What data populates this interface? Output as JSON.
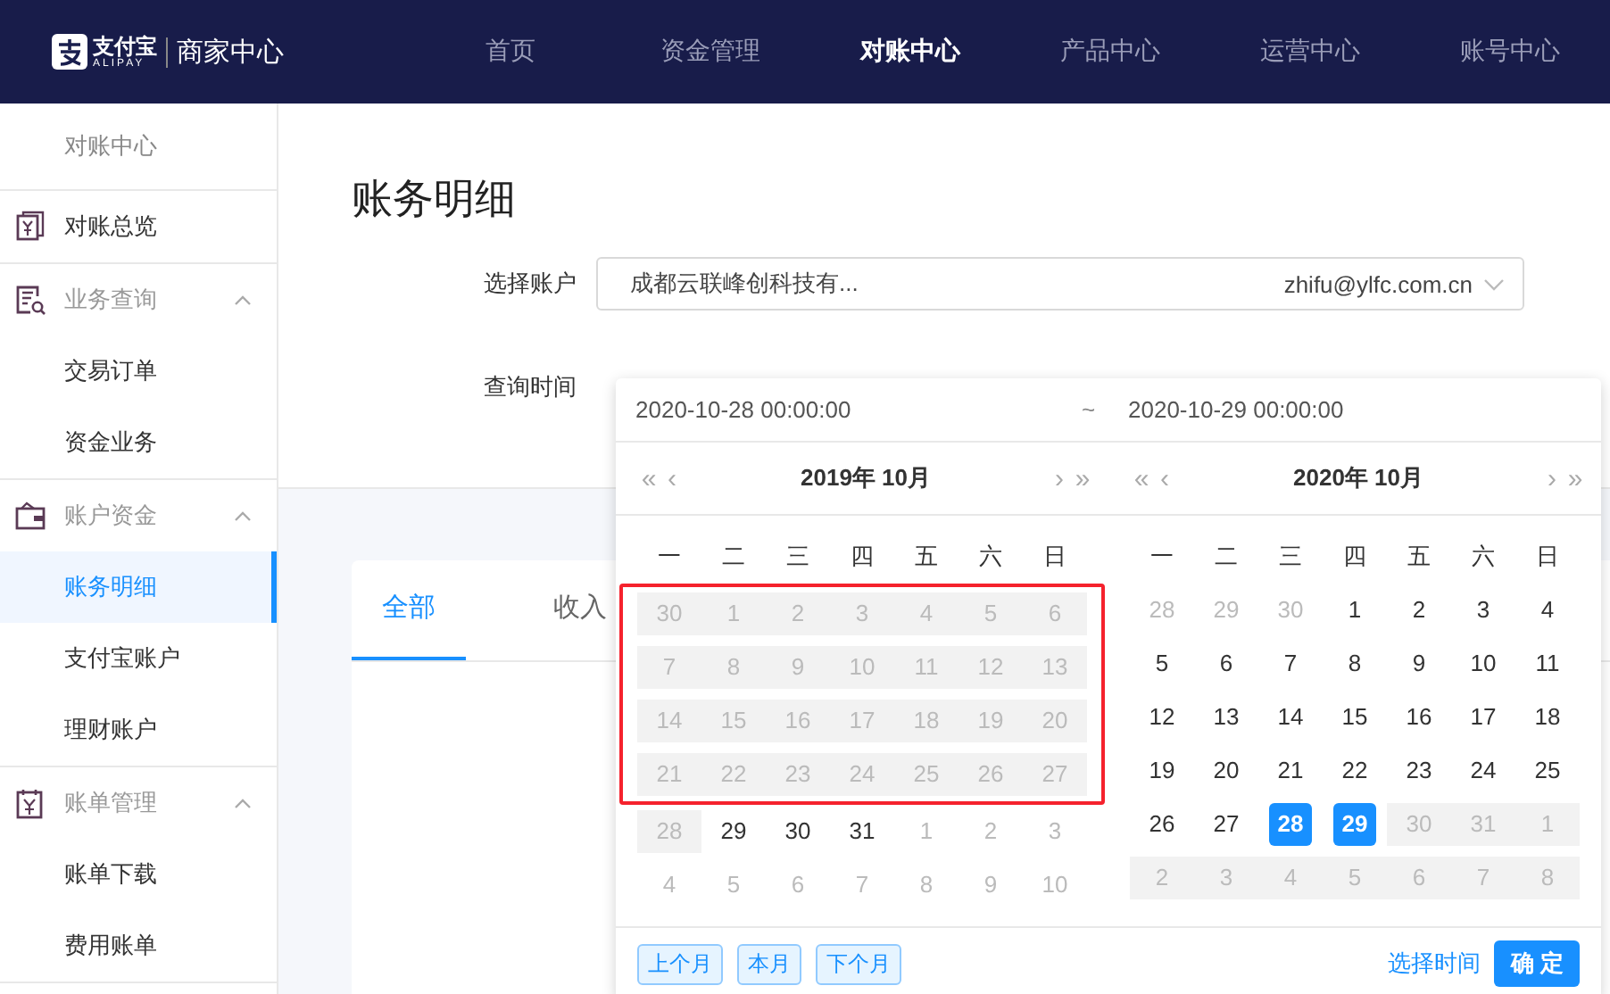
{
  "header": {
    "logo_mark": "支付宝",
    "logo_sub": "ALIPAY",
    "product": "商家中心",
    "nav": [
      {
        "label": "首页",
        "selected": false
      },
      {
        "label": "资金管理",
        "selected": false
      },
      {
        "label": "对账中心",
        "selected": true
      },
      {
        "label": "产品中心",
        "selected": false
      },
      {
        "label": "运营中心",
        "selected": false
      },
      {
        "label": "账号中心",
        "selected": false
      }
    ]
  },
  "sidebar": {
    "title": "对账中心",
    "items": [
      {
        "label": "对账总览",
        "selected": false
      },
      {
        "label": "业务查询",
        "expanded": true,
        "selected": false,
        "children": [
          {
            "label": "交易订单",
            "selected": false
          },
          {
            "label": "资金业务",
            "selected": false
          }
        ]
      },
      {
        "label": "账户资金",
        "expanded": true,
        "selected": false,
        "children": [
          {
            "label": "账务明细",
            "selected": true
          },
          {
            "label": "支付宝账户",
            "selected": false
          },
          {
            "label": "理财账户",
            "selected": false
          }
        ]
      },
      {
        "label": "账单管理",
        "expanded": true,
        "selected": false,
        "children": [
          {
            "label": "账单下载",
            "selected": false
          },
          {
            "label": "费用账单",
            "selected": false
          }
        ]
      }
    ]
  },
  "page": {
    "title": "账务明细",
    "account": {
      "label": "选择账户",
      "name": "成都云联峰创科技有...",
      "email": "zhifu@ylfc.com.cn"
    },
    "time_label": "查询时间",
    "tabs": [
      {
        "label": "全部",
        "selected": true
      },
      {
        "label": "收入",
        "selected": false
      }
    ]
  },
  "date_picker": {
    "start": "2020-10-28 00:00:00",
    "separator": "~",
    "end": "2020-10-29 00:00:00",
    "calendars": [
      {
        "title": "2019年 10月",
        "nav": {
          "prev_year": "«",
          "prev_month": "‹",
          "next_month": "›",
          "next_year": "»"
        },
        "weekdays": [
          "一",
          "二",
          "三",
          "四",
          "五",
          "六",
          "日"
        ],
        "groups": [
          {
            "highlighted": true,
            "weeks": [
              [
                {
                  "day": "30",
                  "kind": "disabled",
                  "selected": false
                },
                {
                  "day": "1",
                  "kind": "disabled",
                  "selected": false
                },
                {
                  "day": "2",
                  "kind": "disabled",
                  "selected": false
                },
                {
                  "day": "3",
                  "kind": "disabled",
                  "selected": false
                },
                {
                  "day": "4",
                  "kind": "disabled",
                  "selected": false
                },
                {
                  "day": "5",
                  "kind": "disabled",
                  "selected": false
                },
                {
                  "day": "6",
                  "kind": "disabled",
                  "selected": false
                }
              ],
              [
                {
                  "day": "7",
                  "kind": "disabled",
                  "selected": false
                },
                {
                  "day": "8",
                  "kind": "disabled",
                  "selected": false
                },
                {
                  "day": "9",
                  "kind": "disabled",
                  "selected": false
                },
                {
                  "day": "10",
                  "kind": "disabled",
                  "selected": false
                },
                {
                  "day": "11",
                  "kind": "disabled",
                  "selected": false
                },
                {
                  "day": "12",
                  "kind": "disabled",
                  "selected": false
                },
                {
                  "day": "13",
                  "kind": "disabled",
                  "selected": false
                }
              ],
              [
                {
                  "day": "14",
                  "kind": "disabled",
                  "selected": false
                },
                {
                  "day": "15",
                  "kind": "disabled",
                  "selected": false
                },
                {
                  "day": "16",
                  "kind": "disabled",
                  "selected": false
                },
                {
                  "day": "17",
                  "kind": "disabled",
                  "selected": false
                },
                {
                  "day": "18",
                  "kind": "disabled",
                  "selected": false
                },
                {
                  "day": "19",
                  "kind": "disabled",
                  "selected": false
                },
                {
                  "day": "20",
                  "kind": "disabled",
                  "selected": false
                }
              ],
              [
                {
                  "day": "21",
                  "kind": "disabled",
                  "selected": false
                },
                {
                  "day": "22",
                  "kind": "disabled",
                  "selected": false
                },
                {
                  "day": "23",
                  "kind": "disabled",
                  "selected": false
                },
                {
                  "day": "24",
                  "kind": "disabled",
                  "selected": false
                },
                {
                  "day": "25",
                  "kind": "disabled",
                  "selected": false
                },
                {
                  "day": "26",
                  "kind": "disabled",
                  "selected": false
                },
                {
                  "day": "27",
                  "kind": "disabled",
                  "selected": false
                }
              ]
            ]
          },
          {
            "highlighted": false,
            "weeks": [
              [
                {
                  "day": "28",
                  "kind": "disabled",
                  "selected": false
                },
                {
                  "day": "29",
                  "kind": "current",
                  "selected": false
                },
                {
                  "day": "30",
                  "kind": "current",
                  "selected": false
                },
                {
                  "day": "31",
                  "kind": "current",
                  "selected": false
                },
                {
                  "day": "1",
                  "kind": "outside",
                  "selected": false
                },
                {
                  "day": "2",
                  "kind": "outside",
                  "selected": false
                },
                {
                  "day": "3",
                  "kind": "outside",
                  "selected": false
                }
              ],
              [
                {
                  "day": "4",
                  "kind": "outside",
                  "selected": false
                },
                {
                  "day": "5",
                  "kind": "outside",
                  "selected": false
                },
                {
                  "day": "6",
                  "kind": "outside",
                  "selected": false
                },
                {
                  "day": "7",
                  "kind": "outside",
                  "selected": false
                },
                {
                  "day": "8",
                  "kind": "outside",
                  "selected": false
                },
                {
                  "day": "9",
                  "kind": "outside",
                  "selected": false
                },
                {
                  "day": "10",
                  "kind": "outside",
                  "selected": false
                }
              ]
            ]
          }
        ]
      },
      {
        "title": "2020年 10月",
        "nav": {
          "prev_year": "«",
          "prev_month": "‹",
          "next_month": "›",
          "next_year": "»"
        },
        "weekdays": [
          "一",
          "二",
          "三",
          "四",
          "五",
          "六",
          "日"
        ],
        "groups": [
          {
            "highlighted": false,
            "weeks": [
              [
                {
                  "day": "28",
                  "kind": "outside",
                  "selected": false
                },
                {
                  "day": "29",
                  "kind": "outside",
                  "selected": false
                },
                {
                  "day": "30",
                  "kind": "outside",
                  "selected": false
                },
                {
                  "day": "1",
                  "kind": "current",
                  "selected": false
                },
                {
                  "day": "2",
                  "kind": "current",
                  "selected": false
                },
                {
                  "day": "3",
                  "kind": "current",
                  "selected": false
                },
                {
                  "day": "4",
                  "kind": "current",
                  "selected": false
                }
              ],
              [
                {
                  "day": "5",
                  "kind": "current",
                  "selected": false
                },
                {
                  "day": "6",
                  "kind": "current",
                  "selected": false
                },
                {
                  "day": "7",
                  "kind": "current",
                  "selected": false
                },
                {
                  "day": "8",
                  "kind": "current",
                  "selected": false
                },
                {
                  "day": "9",
                  "kind": "current",
                  "selected": false
                },
                {
                  "day": "10",
                  "kind": "current",
                  "selected": false
                },
                {
                  "day": "11",
                  "kind": "current",
                  "selected": false
                }
              ],
              [
                {
                  "day": "12",
                  "kind": "current",
                  "selected": false
                },
                {
                  "day": "13",
                  "kind": "current",
                  "selected": false
                },
                {
                  "day": "14",
                  "kind": "current",
                  "selected": false
                },
                {
                  "day": "15",
                  "kind": "current",
                  "selected": false
                },
                {
                  "day": "16",
                  "kind": "current",
                  "selected": false
                },
                {
                  "day": "17",
                  "kind": "current",
                  "selected": false
                },
                {
                  "day": "18",
                  "kind": "current",
                  "selected": false
                }
              ],
              [
                {
                  "day": "19",
                  "kind": "current",
                  "selected": false
                },
                {
                  "day": "20",
                  "kind": "current",
                  "selected": false
                },
                {
                  "day": "21",
                  "kind": "current",
                  "selected": false
                },
                {
                  "day": "22",
                  "kind": "current",
                  "selected": false
                },
                {
                  "day": "23",
                  "kind": "current",
                  "selected": false
                },
                {
                  "day": "24",
                  "kind": "current",
                  "selected": false
                },
                {
                  "day": "25",
                  "kind": "current",
                  "selected": false
                }
              ],
              [
                {
                  "day": "26",
                  "kind": "current",
                  "selected": false
                },
                {
                  "day": "27",
                  "kind": "current",
                  "selected": false
                },
                {
                  "day": "28",
                  "kind": "current",
                  "selected": true
                },
                {
                  "day": "29",
                  "kind": "current",
                  "selected": true
                },
                {
                  "day": "30",
                  "kind": "disabled",
                  "selected": false
                },
                {
                  "day": "31",
                  "kind": "disabled",
                  "selected": false
                },
                {
                  "day": "1",
                  "kind": "disabled",
                  "selected": false
                }
              ],
              [
                {
                  "day": "2",
                  "kind": "disabled",
                  "selected": false
                },
                {
                  "day": "3",
                  "kind": "disabled",
                  "selected": false
                },
                {
                  "day": "4",
                  "kind": "disabled",
                  "selected": false
                },
                {
                  "day": "5",
                  "kind": "disabled",
                  "selected": false
                },
                {
                  "day": "6",
                  "kind": "disabled",
                  "selected": false
                },
                {
                  "day": "7",
                  "kind": "disabled",
                  "selected": false
                },
                {
                  "day": "8",
                  "kind": "disabled",
                  "selected": false
                }
              ]
            ]
          }
        ]
      }
    ],
    "shortcuts": [
      "上个月",
      "本月",
      "下个月"
    ],
    "time_link": "选择时间",
    "confirm": "确 定"
  }
}
